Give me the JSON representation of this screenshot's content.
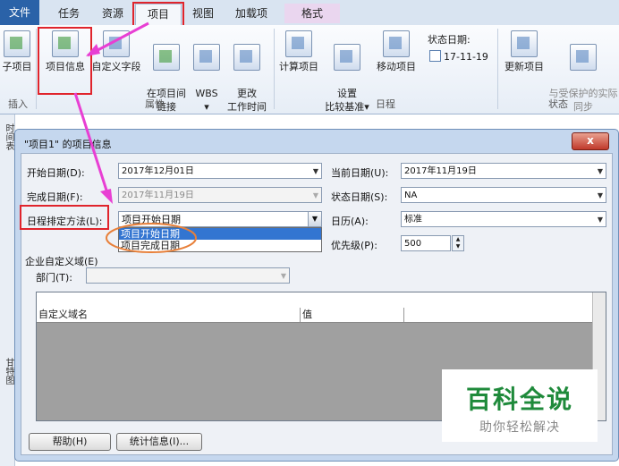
{
  "tabs": [
    {
      "label": "文件",
      "kind": "file"
    },
    {
      "label": "任务",
      "kind": "normal"
    },
    {
      "label": "资源",
      "kind": "normal"
    },
    {
      "label": "项目",
      "kind": "active"
    },
    {
      "label": "视图",
      "kind": "normal"
    },
    {
      "label": "加载项",
      "kind": "normal"
    },
    {
      "label": "格式",
      "kind": "format"
    }
  ],
  "ribbon": {
    "buttons": [
      {
        "label": "子项目",
        "icon": "subproject-icon"
      },
      {
        "label": "项目信息",
        "icon": "project-info-icon"
      },
      {
        "label": "自定义字段",
        "icon": "custom-fields-icon"
      },
      {
        "label": "在项目间\n链接",
        "icon": "link-projects-icon"
      },
      {
        "label": "WBS\n▾",
        "icon": "wbs-icon"
      },
      {
        "label": "更改\n工作时间",
        "icon": "change-working-time-icon"
      },
      {
        "label": "计算项目",
        "icon": "calculate-project-icon"
      },
      {
        "label": "设置\n比较基准▾",
        "icon": "set-baseline-icon"
      },
      {
        "label": "移动项目",
        "icon": "move-project-icon"
      },
      {
        "label": "更新项目",
        "icon": "update-project-icon"
      },
      {
        "label": "与受保护的实际\n同步",
        "icon": "sync-protected-icon"
      }
    ],
    "status_date_label": "状态日期:",
    "status_date_value": "17-11-19",
    "groups": [
      "插入",
      "属性",
      "日程",
      "状态"
    ]
  },
  "side_strip": {
    "top": "时间表",
    "bottom": "甘特图"
  },
  "dialog": {
    "title": "\"项目1\" 的项目信息",
    "close": "x",
    "start_date": {
      "label": "开始日期(D):",
      "value": "2017年12月01日"
    },
    "finish_date": {
      "label": "完成日期(F):",
      "value": "2017年11月19日"
    },
    "schedule_from": {
      "label": "日程排定方法(L):",
      "value": "项目开始日期"
    },
    "schedule_options": [
      "项目开始日期",
      "项目完成日期"
    ],
    "current_date": {
      "label": "当前日期(U):",
      "value": "2017年11月19日"
    },
    "status_date": {
      "label": "状态日期(S):",
      "value": "NA"
    },
    "calendar": {
      "label": "日历(A):",
      "value": "标准"
    },
    "priority": {
      "label": "优先级(P):",
      "value": "500"
    },
    "enterprise_label": "企业自定义域(E)",
    "department_label": "部门(T):",
    "grid_cols": [
      "自定义域名",
      "值"
    ],
    "help_button": "帮助(H)",
    "stats_button": "统计信息(I)..."
  },
  "watermark": {
    "title": "百科全说",
    "subtitle": "助你轻松解决"
  },
  "colors": {
    "accent": "#2a62a8",
    "highlight": "#e0242c",
    "arrow": "#e83fd3",
    "circle": "#e8803a"
  }
}
